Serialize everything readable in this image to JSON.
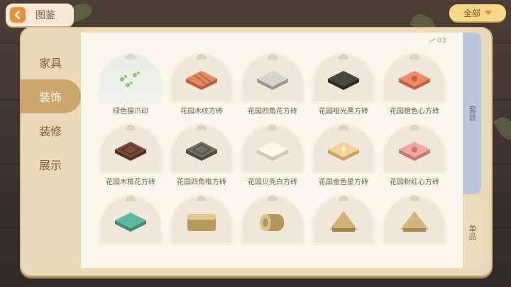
{
  "header": {
    "title": "图鉴",
    "filter_label": "全部"
  },
  "side_tabs": [
    {
      "label": "家具",
      "active": false
    },
    {
      "label": "装饰",
      "active": true
    },
    {
      "label": "装修",
      "active": false
    },
    {
      "label": "展示",
      "active": false
    }
  ],
  "right_tabs": {
    "top_label": "套装",
    "bottom_label": "单品"
  },
  "page_indicator": "03",
  "items": [
    {
      "label": "绿色猫爪印",
      "icon": "paw-print-icon",
      "top": "#8dc07a",
      "side": "#6fa062"
    },
    {
      "label": "花园木纹方砖",
      "icon": "wood-tile-icon",
      "top": "#e2875f",
      "side": "#b8603e"
    },
    {
      "label": "花园四角花方砖",
      "icon": "gray-flower-tile-icon",
      "top": "#d6d2cd",
      "side": "#9e9892"
    },
    {
      "label": "花园哑光黑方砖",
      "icon": "black-tile-icon",
      "top": "#4a4641",
      "side": "#2d2a27"
    },
    {
      "label": "花园橙色心方砖",
      "icon": "orange-heart-tile-icon",
      "top": "#f08a66",
      "side": "#c25f45"
    },
    {
      "label": "花园木框花方砖",
      "icon": "wood-frame-tile-icon",
      "top": "#7b4a36",
      "side": "#553123"
    },
    {
      "label": "花园四角框方砖",
      "icon": "dark-frame-tile-icon",
      "top": "#727061",
      "side": "#4e4c41"
    },
    {
      "label": "花园贝壳白方砖",
      "icon": "shell-white-tile-icon",
      "top": "#fbf6ec",
      "side": "#cfc6b6"
    },
    {
      "label": "花园金色星方砖",
      "icon": "gold-star-tile-icon",
      "top": "#f3d398",
      "side": "#c9a163"
    },
    {
      "label": "花园粉红心方砖",
      "icon": "pink-heart-tile-icon",
      "top": "#f2a5a0",
      "side": "#c57772"
    },
    {
      "label": "",
      "icon": "teal-tile-icon",
      "top": "#5fb8a0",
      "side": "#3d8b77"
    },
    {
      "label": "",
      "icon": "hay-bale-icon",
      "top": "#e1c88f",
      "side": "#b89a5c"
    },
    {
      "label": "",
      "icon": "hay-roll-icon",
      "top": "#dcc38a",
      "side": "#b3955a"
    },
    {
      "label": "",
      "icon": "straw-hut-icon",
      "top": "#d2b077",
      "side": "#a3824c"
    },
    {
      "label": "",
      "icon": "straw-tent-icon",
      "top": "#d6b47a",
      "side": "#a8864f"
    }
  ]
}
